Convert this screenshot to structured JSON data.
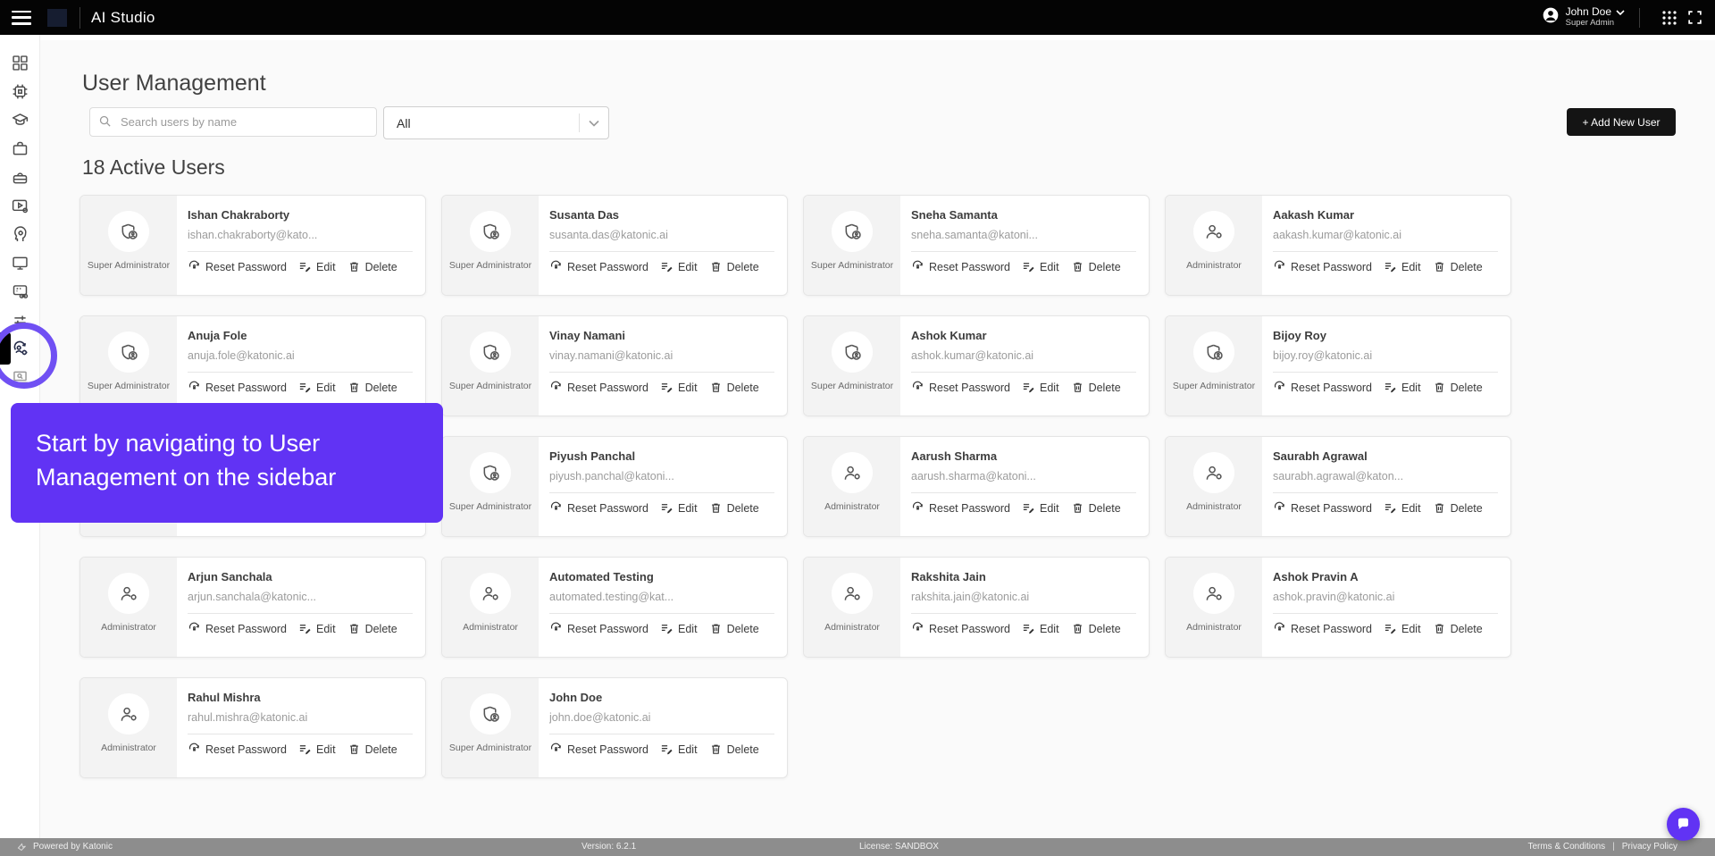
{
  "topbar": {
    "app_title": "AI Studio",
    "user": {
      "name": "John Doe",
      "role": "Super Admin"
    }
  },
  "sidebar": {
    "icons": [
      "dashboard",
      "chip",
      "education",
      "briefcase",
      "toolbox",
      "media-settings",
      "ai-head",
      "monitor",
      "card-link",
      "sliders",
      "user-management",
      "laptop-search"
    ],
    "active": "user-management"
  },
  "page": {
    "title": "User Management",
    "search_placeholder": "Search users by name",
    "filter_value": "All",
    "add_user_label": "+ Add New User",
    "active_users_heading": "18 Active Users"
  },
  "actions": {
    "reset": "Reset Password",
    "edit": "Edit",
    "delete": "Delete"
  },
  "users": [
    {
      "name": "Ishan Chakraborty",
      "email": "ishan.chakraborty@kato...",
      "role": "Super Administrator"
    },
    {
      "name": "Susanta Das",
      "email": "susanta.das@katonic.ai",
      "role": "Super Administrator"
    },
    {
      "name": "Sneha Samanta",
      "email": "sneha.samanta@katoni...",
      "role": "Super Administrator"
    },
    {
      "name": "Aakash Kumar",
      "email": "aakash.kumar@katonic.ai",
      "role": "Administrator"
    },
    {
      "name": "Anuja Fole",
      "email": "anuja.fole@katonic.ai",
      "role": "Super Administrator"
    },
    {
      "name": "Vinay Namani",
      "email": "vinay.namani@katonic.ai",
      "role": "Super Administrator"
    },
    {
      "name": "Ashok Kumar",
      "email": "ashok.kumar@katonic.ai",
      "role": "Super Administrator"
    },
    {
      "name": "Bijoy Roy",
      "email": "bijoy.roy@katonic.ai",
      "role": "Super Administrator"
    },
    {
      "name": "",
      "email": "",
      "role": "",
      "covered": true
    },
    {
      "name": "Piyush Panchal",
      "email": "piyush.panchal@katoni...",
      "role": "Super Administrator"
    },
    {
      "name": "Aarush Sharma",
      "email": "aarush.sharma@katoni...",
      "role": "Administrator"
    },
    {
      "name": "Saurabh Agrawal",
      "email": "saurabh.agrawal@katon...",
      "role": "Administrator"
    },
    {
      "name": "Arjun Sanchala",
      "email": "arjun.sanchala@katonic...",
      "role": "Administrator"
    },
    {
      "name": "Automated Testing",
      "email": "automated.testing@kat...",
      "role": "Administrator"
    },
    {
      "name": "Rakshita Jain",
      "email": "rakshita.jain@katonic.ai",
      "role": "Administrator"
    },
    {
      "name": "Ashok Pravin A",
      "email": "ashok.pravin@katonic.ai",
      "role": "Administrator"
    },
    {
      "name": "Rahul Mishra",
      "email": "rahul.mishra@katonic.ai",
      "role": "Administrator"
    },
    {
      "name": "John Doe",
      "email": "john.doe@katonic.ai",
      "role": "Super Administrator"
    }
  ],
  "tooltip": {
    "text": "Start by navigating to User Management on the sidebar"
  },
  "footer": {
    "powered": "Powered by Katonic",
    "version": "Version: 6.2.1",
    "license": "License: SANDBOX",
    "terms": "Terms & Conditions",
    "separator": "|",
    "privacy": "Privacy Policy"
  },
  "colors": {
    "accent": "#6133f4",
    "topbar": "#040404",
    "footer": "#8d8d8d"
  }
}
